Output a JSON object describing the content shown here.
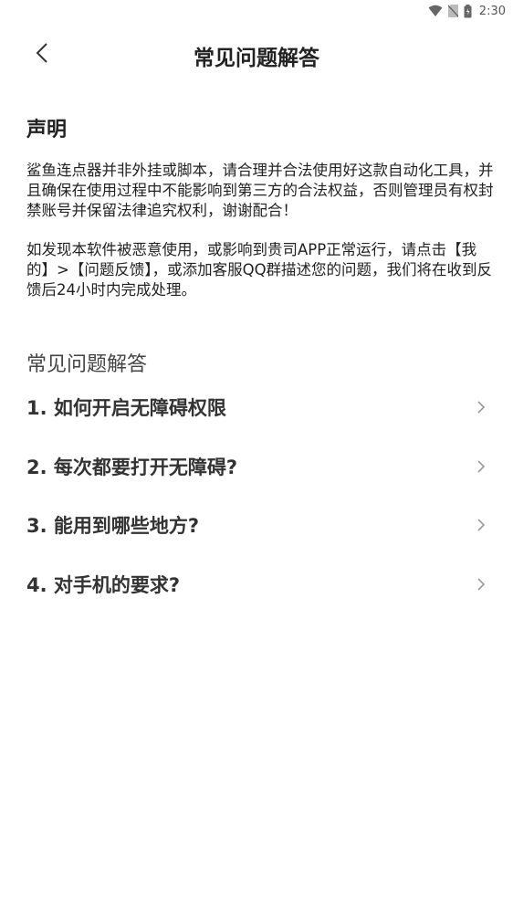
{
  "status_bar": {
    "time": "2:30",
    "icons": [
      "wifi-icon",
      "no-sim-icon",
      "battery-icon"
    ]
  },
  "header": {
    "title": "常见问题解答",
    "back_icon": "chevron-left-icon"
  },
  "statement": {
    "heading": "声明",
    "paragraph1": "鲨鱼连点器并非外挂或脚本，请合理并合法使用好这款自动化工具，并且确保在使用过程中不能影响到第三方的合法权益，否则管理员有权封禁账号并保留法律追究权利，谢谢配合！",
    "paragraph2": "如发现本软件被恶意使用，或影响到贵司APP正常运行，请点击【我的】>【问题反馈】，或添加客服QQ群描述您的问题，我们将在收到反馈后24小时内完成处理。"
  },
  "faq": {
    "heading": "常见问题解答",
    "items": [
      {
        "label": "1. 如何开启无障碍权限"
      },
      {
        "label": "2. 每次都要打开无障碍?"
      },
      {
        "label": "3. 能用到哪些地方?"
      },
      {
        "label": "4. 对手机的要求?"
      }
    ],
    "item_icon": "chevron-right-icon"
  },
  "colors": {
    "background": "#ffffff",
    "text": "#222222",
    "chevron": "#9a9a9a"
  }
}
